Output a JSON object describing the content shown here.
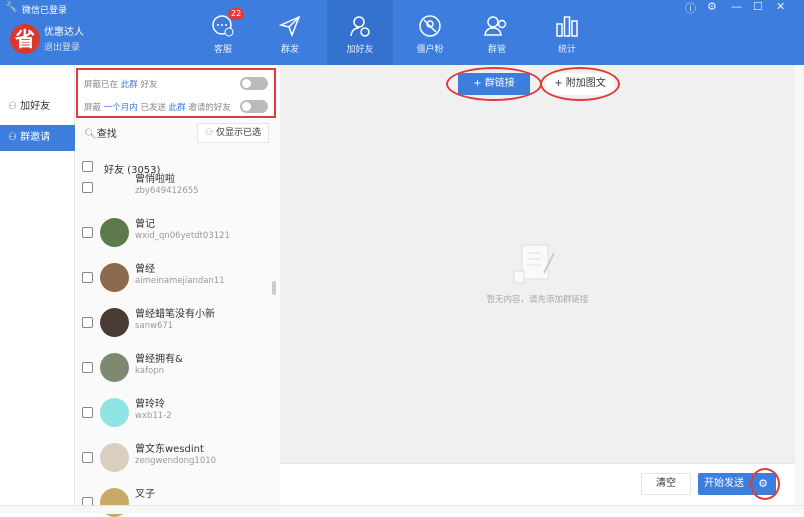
{
  "window": {
    "title": "微信已登录"
  },
  "user": {
    "logo_char": "省",
    "name": "优惠达人",
    "logout": "退出登录"
  },
  "nav": [
    {
      "label": "客服",
      "badge": "22"
    },
    {
      "label": "群发"
    },
    {
      "label": "加好友"
    },
    {
      "label": "僵户粉"
    },
    {
      "label": "群管"
    },
    {
      "label": "统计"
    }
  ],
  "sidebar": {
    "items": [
      {
        "label": "加好友"
      },
      {
        "label": "群邀请"
      }
    ]
  },
  "filters": {
    "row1": {
      "a": "屏蔽已在",
      "b": "此群",
      "c": "好友"
    },
    "row2": {
      "a": "屏蔽",
      "b": "一个月内",
      "c": "已发送",
      "d": "此群",
      "e": "邀请的好友"
    }
  },
  "search": {
    "label": "查找",
    "only_selected": "仅显示已选"
  },
  "group": {
    "label": "好友 (3053)"
  },
  "friends": [
    {
      "name": "曾悄啦啦",
      "id": "zby649412655",
      "color": "#ccc"
    },
    {
      "name": "曾记",
      "id": "wxid_qn06yetdt03121",
      "color": "#5d7a4c"
    },
    {
      "name": "曾经",
      "id": "aimeinamejiandan11",
      "color": "#8b6a4d"
    },
    {
      "name": "曾经蜡笔没有小新",
      "id": "sanw671",
      "color": "#4a3a34"
    },
    {
      "name": "曾经拥有&",
      "id": "kafopn",
      "color": "#7d8a70"
    },
    {
      "name": "曾玲玲",
      "id": "wxb11-2",
      "color": "#8fe3e3"
    },
    {
      "name": "曾文东wesdint",
      "id": "zengwendong1010",
      "color": "#d8cfc0"
    },
    {
      "name": "叉子",
      "id": "",
      "color": "#c9a86a"
    }
  ],
  "main": {
    "add_link": "+ 群链接",
    "add_media": "+ 附加图文",
    "empty": "暂无内容，请先添加群链接"
  },
  "bottom": {
    "clear": "清空",
    "send": "开始发送"
  },
  "colors": {
    "brand": "#3c7ddd",
    "highlight": "#e03a3a"
  }
}
